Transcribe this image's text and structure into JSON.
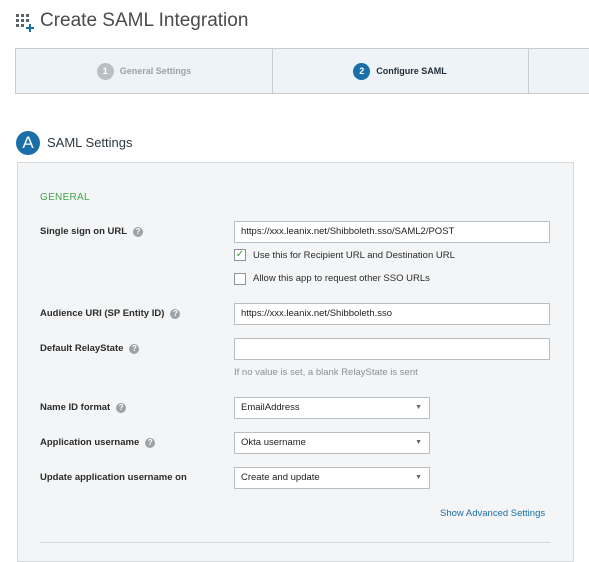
{
  "page": {
    "title": "Create SAML Integration",
    "icon": "grid-add-icon"
  },
  "wizard": {
    "steps": [
      {
        "number": "1",
        "label": "General Settings",
        "state": "done"
      },
      {
        "number": "2",
        "label": "Configure SAML",
        "state": "active"
      }
    ]
  },
  "section": {
    "badge": "A",
    "title": "SAML Settings"
  },
  "form": {
    "group_title": "GENERAL",
    "sso_url": {
      "label": "Single sign on URL",
      "value": "https://xxx.leanix.net/Shibboleth.sso/SAML2/POST"
    },
    "recipient_checkbox": {
      "label": "Use this for Recipient URL and Destination URL",
      "checked": true,
      "mark": "✓"
    },
    "allow_other_sso": {
      "label": "Allow this app to request other SSO URLs",
      "checked": false
    },
    "audience_uri": {
      "label": "Audience URI (SP Entity ID)",
      "value": "https://xxx.leanix.net/Shibboleth.sso"
    },
    "relay_state": {
      "label": "Default RelayState",
      "value": "",
      "hint": "If no value is set, a blank RelayState is sent"
    },
    "name_id_format": {
      "label": "Name ID format",
      "value": "EmailAddress"
    },
    "app_username": {
      "label": "Application username",
      "value": "Okta username"
    },
    "update_username_on": {
      "label": "Update application username on",
      "value": "Create and update"
    },
    "advanced_link": "Show Advanced Settings",
    "help_glyph": "?",
    "caret_glyph": "▼"
  },
  "colors": {
    "accent": "#1a6fa8",
    "group_title": "#45a34a",
    "check": "#3e9b43"
  }
}
